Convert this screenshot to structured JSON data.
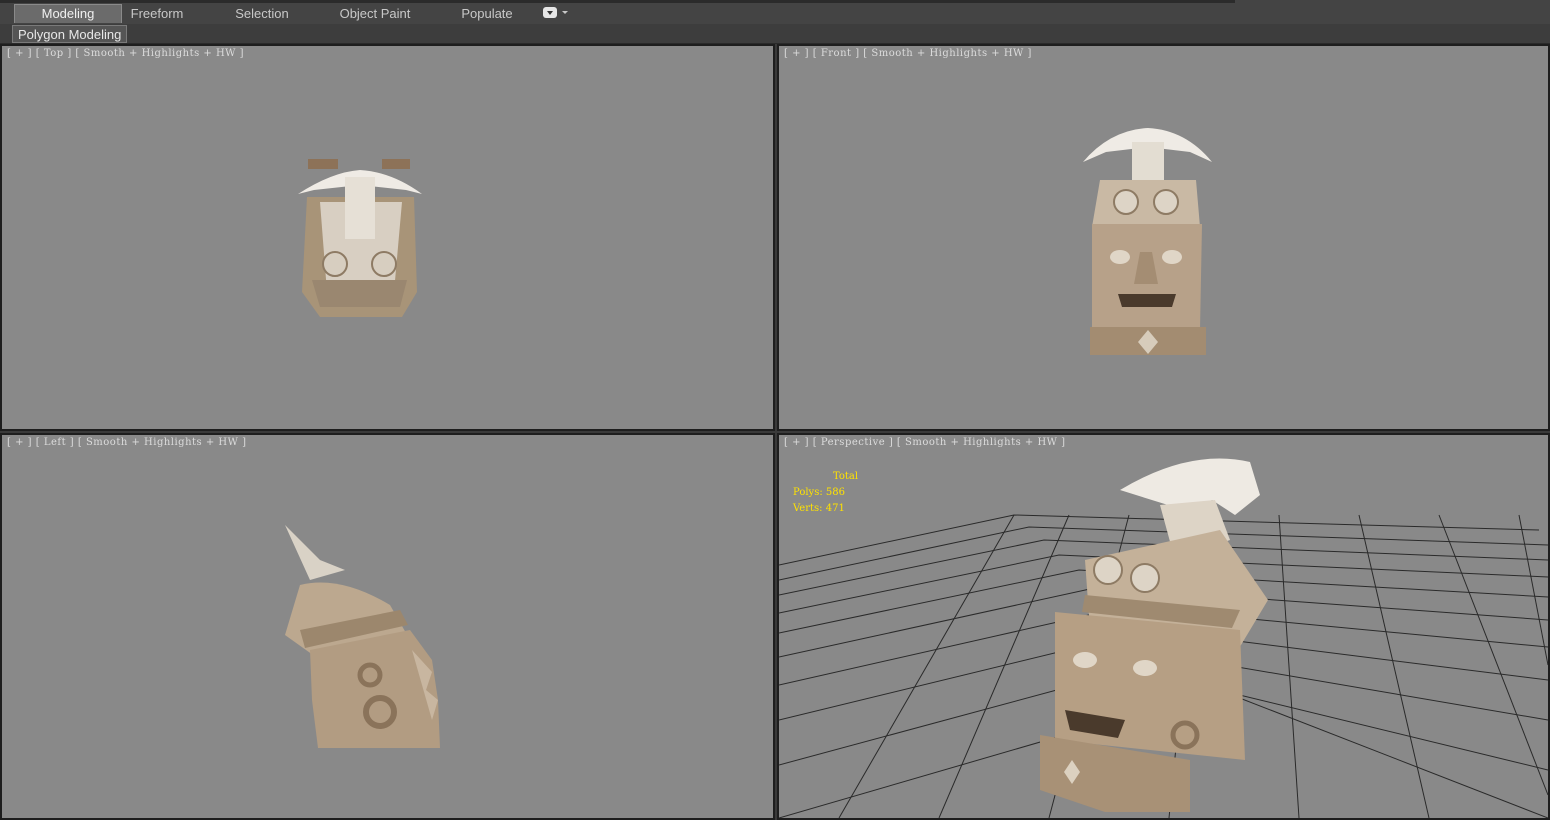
{
  "ribbon": {
    "tabs": [
      {
        "label": "Modeling",
        "active": true
      },
      {
        "label": "Freeform",
        "active": false
      },
      {
        "label": "Selection",
        "active": false
      },
      {
        "label": "Object Paint",
        "active": false
      },
      {
        "label": "Populate",
        "active": false
      }
    ],
    "panel_label": "Polygon Modeling"
  },
  "viewports": {
    "top": {
      "view": "Top",
      "shading": "Smooth + Highlights + HW"
    },
    "front": {
      "view": "Front",
      "shading": "Smooth + Highlights + HW"
    },
    "left": {
      "view": "Left",
      "shading": "Smooth + Highlights + HW"
    },
    "perspective": {
      "view": "Perspective",
      "shading": "Smooth + Highlights + HW"
    }
  },
  "stats": {
    "total_label": "Total",
    "polys_label": "Polys:",
    "polys_value": "586",
    "verts_label": "Verts:",
    "verts_value": "471",
    "color": "#ffe200"
  },
  "colors": {
    "viewport_bg": "#898989",
    "stone": "#b9a48a",
    "stone_light": "#e8e2d8",
    "grid": "#2a2a2a"
  }
}
